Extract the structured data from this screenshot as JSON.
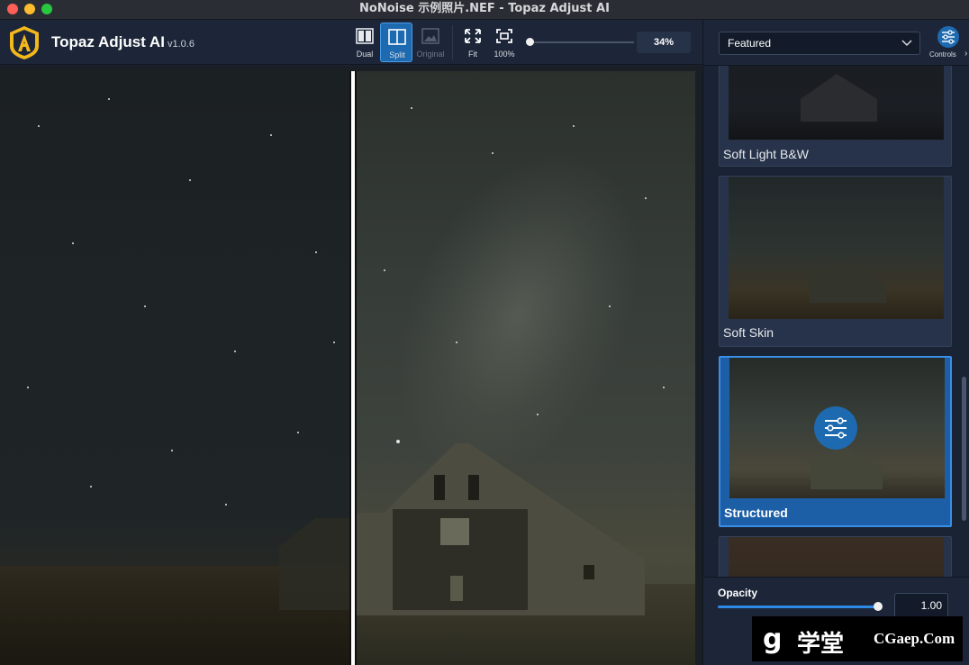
{
  "window": {
    "title": "NoNoise 示例照片.NEF - Topaz Adjust AI"
  },
  "header": {
    "app_name": "Topaz Adjust AI",
    "version": "v1.0.6",
    "view_buttons": [
      {
        "label": "Dual",
        "state": "normal"
      },
      {
        "label": "Split",
        "state": "active"
      },
      {
        "label": "Original",
        "state": "disabled"
      }
    ],
    "zoom_buttons": [
      {
        "label": "Fit"
      },
      {
        "label": "100%"
      }
    ],
    "zoom_value": "34%",
    "zoom_level_fraction": 0.0
  },
  "panel": {
    "preset_category": "Featured",
    "controls_label": "Controls",
    "presets": [
      {
        "label": "Soft Light B&W",
        "selected": false
      },
      {
        "label": "Soft Skin",
        "selected": false
      },
      {
        "label": "Structured",
        "selected": true
      }
    ],
    "opacity_label": "Opacity",
    "opacity_value": "1.00",
    "opacity_fraction": 1.0
  },
  "watermark": {
    "glyph": "g",
    "text_cn": "学堂",
    "domain": "CGaep.Com"
  },
  "colors": {
    "accent": "#1e6ab0",
    "panel_bg": "#1c2638",
    "selected_card": "#1d5fa6"
  }
}
